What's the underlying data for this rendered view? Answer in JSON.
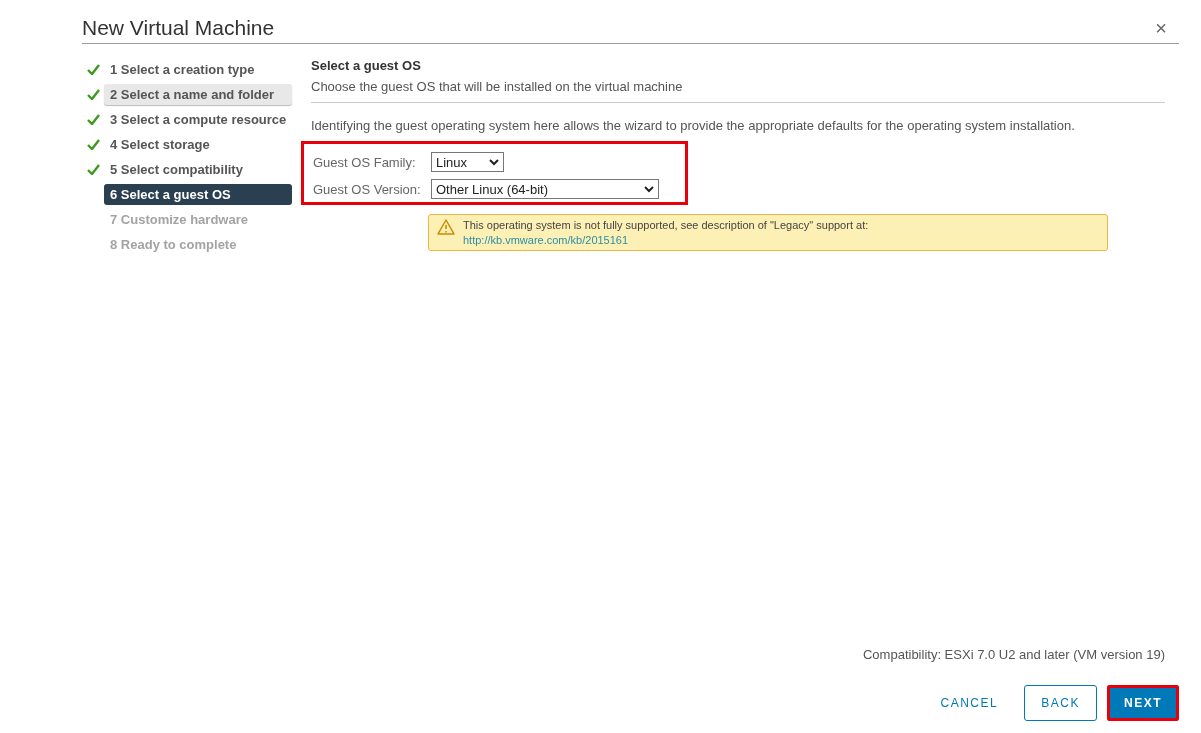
{
  "window": {
    "title": "New Virtual Machine",
    "close": "×"
  },
  "steps": [
    {
      "label": "1 Select a creation type",
      "done": true,
      "selected": false,
      "hovered": false,
      "disabled": false
    },
    {
      "label": "2 Select a name and folder",
      "done": true,
      "selected": false,
      "hovered": true,
      "disabled": false
    },
    {
      "label": "3 Select a compute resource",
      "done": true,
      "selected": false,
      "hovered": false,
      "disabled": false
    },
    {
      "label": "4 Select storage",
      "done": true,
      "selected": false,
      "hovered": false,
      "disabled": false
    },
    {
      "label": "5 Select compatibility",
      "done": true,
      "selected": false,
      "hovered": false,
      "disabled": false
    },
    {
      "label": "6 Select a guest OS",
      "done": false,
      "selected": true,
      "hovered": false,
      "disabled": false
    },
    {
      "label": "7 Customize hardware",
      "done": false,
      "selected": false,
      "hovered": false,
      "disabled": true
    },
    {
      "label": "8 Ready to complete",
      "done": false,
      "selected": false,
      "hovered": false,
      "disabled": true
    }
  ],
  "page": {
    "title": "Select a guest OS",
    "subtitle": "Choose the guest OS that will be installed on the virtual machine",
    "description": "Identifying the guest operating system here allows the wizard to provide the appropriate defaults for the operating system installation."
  },
  "form": {
    "annotated": true,
    "fields": [
      {
        "label": "Guest OS Family:",
        "value": "Linux"
      },
      {
        "label": "Guest OS Version:",
        "value": "Other Linux (64-bit)"
      }
    ]
  },
  "warning": {
    "text": "This operating system is not fully supported, see description of \"Legacy\" support at:",
    "link": "http://kb.vmware.com/kb/2015161"
  },
  "compatibility": "Compatibility: ESXi 7.0 U2 and later (VM version 19)",
  "buttons": [
    {
      "label": "CANCEL",
      "kind": "flat",
      "annotated": false
    },
    {
      "label": "BACK",
      "kind": "outline",
      "annotated": false
    },
    {
      "label": "NEXT",
      "kind": "primary",
      "annotated": true
    }
  ]
}
